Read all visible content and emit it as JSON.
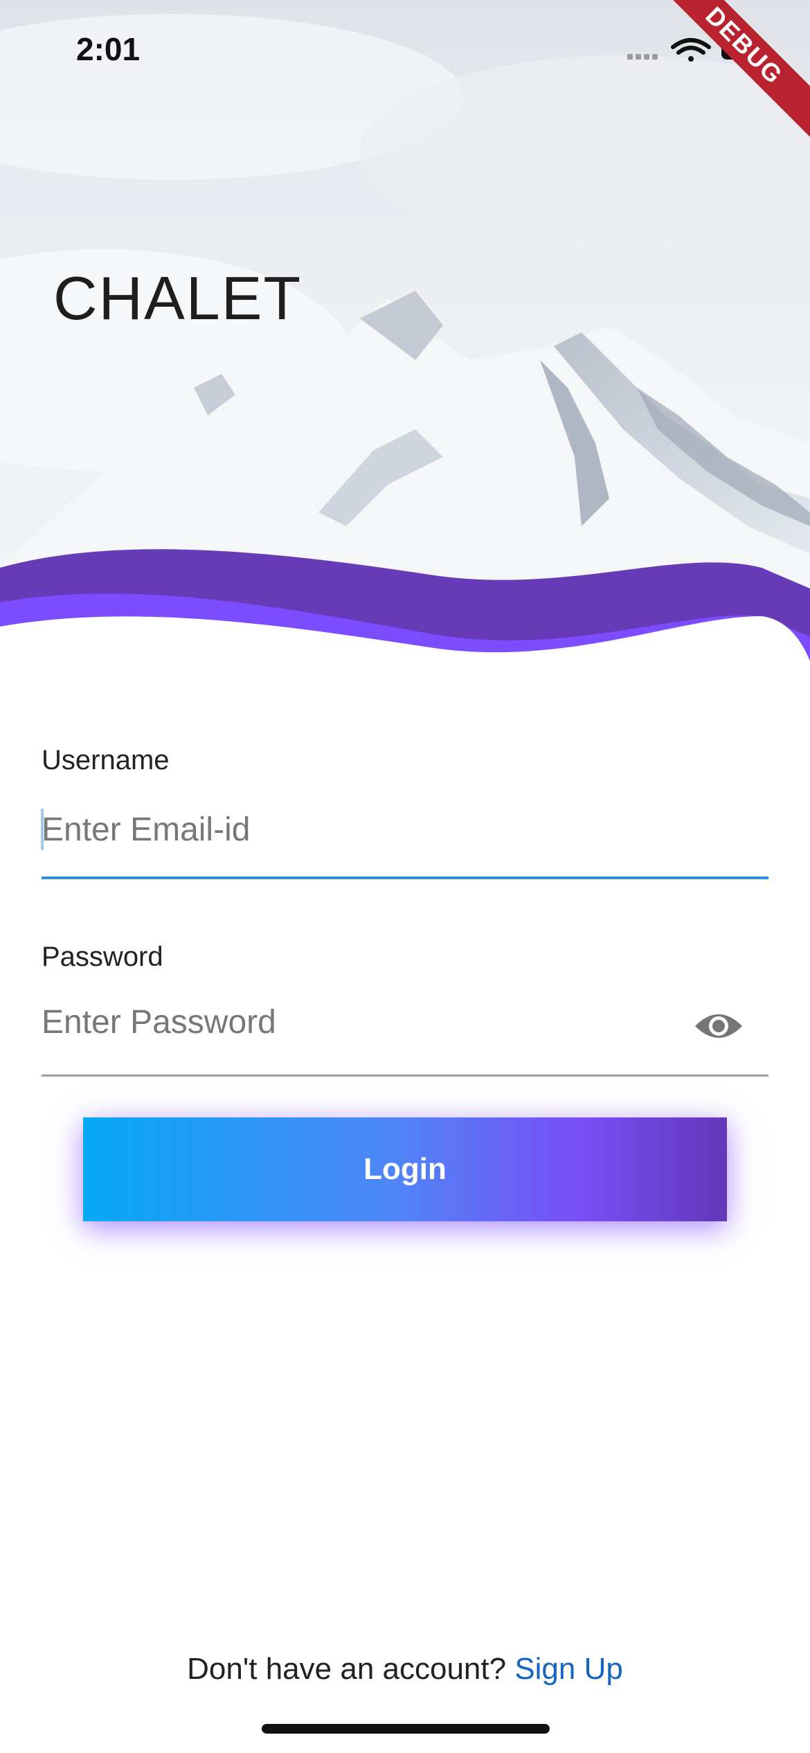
{
  "status_bar": {
    "time": "2:01",
    "signal_icon": "cellular-dots-icon",
    "wifi_icon": "wifi-icon",
    "battery_icon": "battery-icon"
  },
  "debug_banner": "DEBUG",
  "header": {
    "title": "CHALET",
    "background": "snowy-mountain-image",
    "wave_colors": [
      "#673ab7",
      "#7c4dff"
    ]
  },
  "form": {
    "username": {
      "label": "Username",
      "placeholder": "Enter Email-id",
      "value": ""
    },
    "password": {
      "label": "Password",
      "placeholder": "Enter Password",
      "value": "",
      "toggle_icon": "eye-icon"
    },
    "login_label": "Login"
  },
  "footer": {
    "prompt": "Don't have an account?",
    "signup_label": "Sign Up"
  },
  "colors": {
    "accent_focus": "#2e8fe0",
    "link": "#1565c0",
    "gradient": [
      "#04a9f4",
      "#7a4cf5",
      "#6338b8"
    ]
  }
}
